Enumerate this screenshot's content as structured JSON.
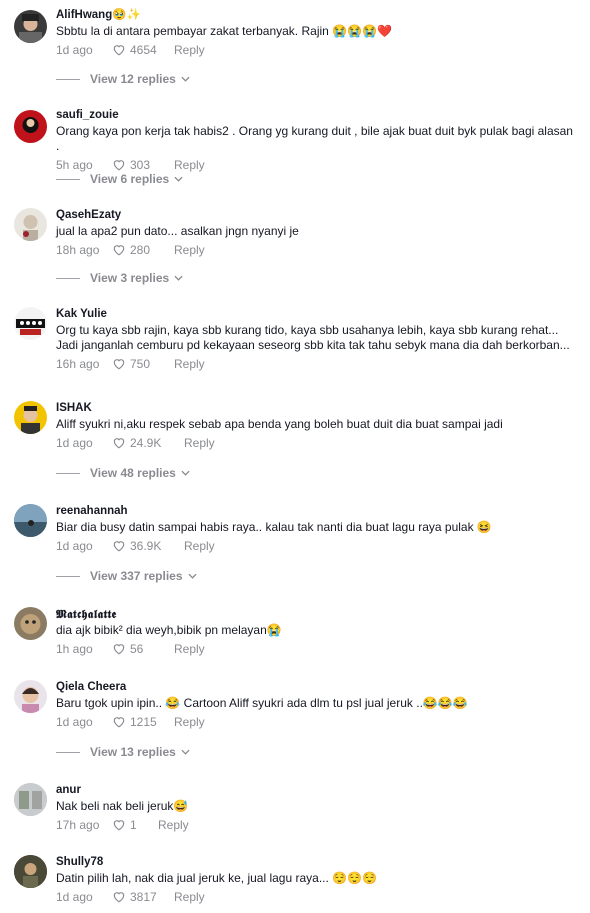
{
  "comments": [
    {
      "user": "AlifHwang🥹✨",
      "text": "Sbbtu la di antara pembayar zakat terbanyak. Rajin 😭😭😭❤️",
      "time": "1d ago",
      "likes": "4654",
      "reply": "Reply",
      "view_replies": "View 12 replies"
    },
    {
      "user": "saufi_zouie",
      "text": "Orang kaya pon kerja tak habis2 . Orang yg kurang duit , bile ajak buat duit byk pulak bagi alasan .",
      "time": "5h ago",
      "likes": "303",
      "reply": "Reply",
      "view_replies": "View 6 replies"
    },
    {
      "user": "QasehEzaty",
      "text": "jual la apa2 pun dato... asalkan jngn nyanyi je",
      "time": "18h ago",
      "likes": "280",
      "reply": "Reply",
      "view_replies": "View 3 replies"
    },
    {
      "user": "Kak Yulie",
      "text": "Org tu kaya sbb rajin, kaya sbb kurang tido, kaya sbb usahanya lebih, kaya sbb kurang rehat... Jadi janganlah cemburu pd kekayaan seseorg sbb kita tak tahu sebyk mana dia dah berkorban...",
      "time": "16h ago",
      "likes": "750",
      "reply": "Reply"
    },
    {
      "user": "ISHAK",
      "text": "Aliff syukri ni,aku respek sebab apa benda yang boleh buat duit dia buat sampai jadi",
      "time": "1d ago",
      "likes": "24.9K",
      "reply": "Reply",
      "view_replies": "View 48 replies"
    },
    {
      "user": "reenahannah",
      "text": "Biar dia busy datin sampai habis raya.. kalau tak nanti dia buat lagu raya pulak 😆",
      "time": "1d ago",
      "likes": "36.9K",
      "reply": "Reply",
      "view_replies": "View 337 replies"
    },
    {
      "user": "𝕸𝖆𝖙𝖈𝖍𝖆𝖑𝖆𝖙𝖙𝖊",
      "text": "dia ajk bibik² dia weyh,bibik pn melayan😭",
      "time": "1h ago",
      "likes": "56",
      "reply": "Reply"
    },
    {
      "user": "Qiela Cheera",
      "text": "Baru tgok upin ipin.. 😂 Cartoon Aliff syukri ada dlm tu psl jual jeruk ..😂😂😂",
      "time": "1d ago",
      "likes": "1215",
      "reply": "Reply",
      "view_replies": "View 13 replies"
    },
    {
      "user": "anur",
      "text": "Nak beli nak beli jeruk😅",
      "time": "17h ago",
      "likes": "1",
      "reply": "Reply"
    },
    {
      "user": "Shully78",
      "text": "Datin pilih lah, nak dia jual jeruk ke, jual lagu raya... 😌😌😌",
      "time": "1d ago",
      "likes": "3817",
      "reply": "Reply"
    }
  ],
  "colors": {
    "text": "#161823",
    "muted": "#8a8b91",
    "heart-outline": "#8a8b91"
  }
}
